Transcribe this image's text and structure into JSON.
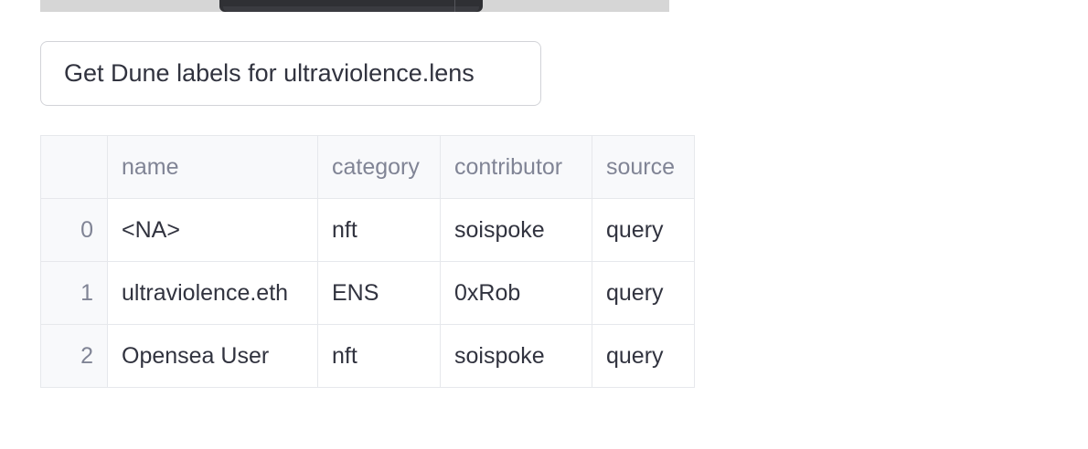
{
  "button": {
    "label": "Get Dune labels for ultraviolence.lens"
  },
  "table": {
    "columns": [
      "",
      "name",
      "category",
      "contributor",
      "source"
    ],
    "rows": [
      {
        "index": "0",
        "name": "<NA>",
        "category": "nft",
        "contributor": "soispoke",
        "source": "query"
      },
      {
        "index": "1",
        "name": "ultraviolence.eth",
        "category": "ENS",
        "contributor": "0xRob",
        "source": "query"
      },
      {
        "index": "2",
        "name": "Opensea User",
        "category": "nft",
        "contributor": "soispoke",
        "source": "query"
      }
    ]
  }
}
